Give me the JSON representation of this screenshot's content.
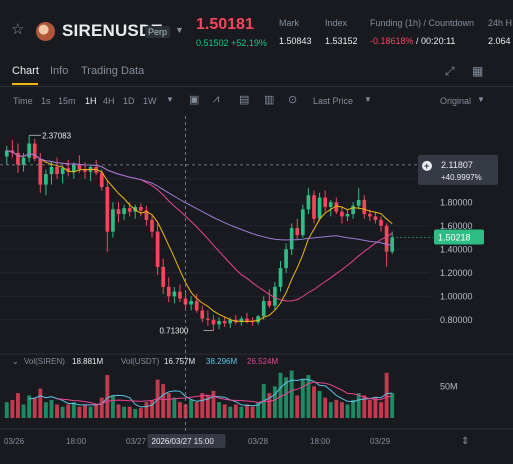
{
  "header": {
    "star_icon": "star-icon",
    "symbol": "SIRENUSDT",
    "contract_badge": "Perp",
    "last_price": "1.50181",
    "sub_price": "0.51502",
    "change_pct": "+52.19%",
    "stats": [
      {
        "label": "Mark",
        "value": "1.50843"
      },
      {
        "label": "Index",
        "value": "1.53152"
      },
      {
        "label": "Funding (1h) / Countdown",
        "value_neg": "-0.18618%",
        "value_rest": " / 00:20:11"
      },
      {
        "label": "24h H",
        "value": "2.064"
      }
    ]
  },
  "tabs": [
    {
      "label": "Chart",
      "active": true
    },
    {
      "label": "Info",
      "active": false
    },
    {
      "label": "Trading Data",
      "active": false
    }
  ],
  "toolbar": {
    "time_label": "Time",
    "timeframes": [
      {
        "label": "1s",
        "active": false
      },
      {
        "label": "15m",
        "active": false
      },
      {
        "label": "1H",
        "active": true
      },
      {
        "label": "4H",
        "active": false
      },
      {
        "label": "1D",
        "active": false
      },
      {
        "label": "1W",
        "active": false
      }
    ],
    "price_type": "Last Price",
    "view_mode": "Original"
  },
  "chart_data": {
    "type": "candlestick",
    "price_axis": [
      "2.00000",
      "1.80000",
      "1.60000",
      "1.40000",
      "1.20000",
      "1.00000",
      "0.80000"
    ],
    "price_range": [
      0.56,
      2.5
    ],
    "high_label": "2.37083",
    "low_label": "0.71300",
    "crosshair": {
      "price": "2.11807",
      "change": "+40.9997%",
      "time": "2026/03/27 15:00"
    },
    "current_price_tag": "1.50218",
    "volume_legend": {
      "name": "Vol(SIREN)",
      "siren": "18.881M",
      "usdt_label": "Vol(USDT)",
      "usdt": "16.757M",
      "ma1": "38.296M",
      "ma2": "26.524M"
    },
    "volume_axis": "50M",
    "time_axis": [
      "03/26",
      "18:00",
      "03/27",
      "18:00",
      "03/28",
      "18:00",
      "03/29"
    ],
    "ohlc": [
      [
        2.19,
        2.28,
        2.12,
        2.24
      ],
      [
        2.24,
        2.33,
        2.18,
        2.22
      ],
      [
        2.22,
        2.3,
        2.05,
        2.12
      ],
      [
        2.12,
        2.22,
        2.06,
        2.18
      ],
      [
        2.18,
        2.37,
        2.14,
        2.3
      ],
      [
        2.3,
        2.34,
        2.15,
        2.17
      ],
      [
        2.17,
        2.22,
        1.88,
        1.95
      ],
      [
        1.95,
        2.08,
        1.86,
        2.04
      ],
      [
        2.04,
        2.15,
        1.95,
        2.1
      ],
      [
        2.1,
        2.18,
        2.0,
        2.04
      ],
      [
        2.04,
        2.12,
        1.96,
        2.09
      ],
      [
        2.09,
        2.16,
        2.02,
        2.06
      ],
      [
        2.06,
        2.14,
        2.0,
        2.12
      ],
      [
        2.12,
        2.2,
        2.05,
        2.08
      ],
      [
        2.08,
        2.14,
        2.0,
        2.06
      ],
      [
        2.06,
        2.12,
        1.98,
        2.1
      ],
      [
        2.1,
        2.16,
        2.03,
        2.05
      ],
      [
        2.05,
        2.08,
        1.9,
        1.93
      ],
      [
        1.93,
        1.98,
        1.38,
        1.55
      ],
      [
        1.55,
        1.8,
        1.5,
        1.74
      ],
      [
        1.74,
        1.8,
        1.63,
        1.7
      ],
      [
        1.7,
        1.78,
        1.65,
        1.75
      ],
      [
        1.75,
        1.8,
        1.68,
        1.72
      ],
      [
        1.72,
        1.78,
        1.66,
        1.76
      ],
      [
        1.76,
        1.79,
        1.68,
        1.73
      ],
      [
        1.73,
        1.77,
        1.6,
        1.65
      ],
      [
        1.65,
        1.7,
        1.5,
        1.55
      ],
      [
        1.55,
        1.62,
        1.18,
        1.25
      ],
      [
        1.25,
        1.32,
        1.02,
        1.08
      ],
      [
        1.08,
        1.16,
        0.95,
        1.0
      ],
      [
        1.0,
        1.08,
        0.94,
        1.04
      ],
      [
        1.04,
        1.1,
        0.95,
        0.98
      ],
      [
        0.98,
        1.04,
        0.9,
        0.93
      ],
      [
        0.93,
        1.0,
        0.88,
        0.96
      ],
      [
        0.96,
        1.02,
        0.86,
        0.88
      ],
      [
        0.88,
        0.92,
        0.78,
        0.81
      ],
      [
        0.81,
        0.88,
        0.75,
        0.8
      ],
      [
        0.8,
        0.84,
        0.71,
        0.76
      ],
      [
        0.76,
        0.82,
        0.72,
        0.79
      ],
      [
        0.79,
        0.83,
        0.74,
        0.77
      ],
      [
        0.77,
        0.82,
        0.73,
        0.8
      ],
      [
        0.8,
        0.84,
        0.76,
        0.78
      ],
      [
        0.78,
        0.83,
        0.75,
        0.81
      ],
      [
        0.81,
        0.86,
        0.77,
        0.79
      ],
      [
        0.79,
        0.82,
        0.75,
        0.78
      ],
      [
        0.78,
        0.84,
        0.76,
        0.83
      ],
      [
        0.83,
        1.0,
        0.8,
        0.96
      ],
      [
        0.96,
        1.06,
        0.9,
        0.92
      ],
      [
        0.92,
        1.12,
        0.88,
        1.08
      ],
      [
        1.08,
        1.3,
        1.04,
        1.24
      ],
      [
        1.24,
        1.45,
        1.2,
        1.4
      ],
      [
        1.4,
        1.62,
        1.35,
        1.58
      ],
      [
        1.58,
        1.66,
        1.48,
        1.52
      ],
      [
        1.52,
        1.78,
        1.5,
        1.74
      ],
      [
        1.74,
        1.92,
        1.7,
        1.86
      ],
      [
        1.86,
        1.9,
        1.62,
        1.66
      ],
      [
        1.66,
        1.88,
        1.64,
        1.84
      ],
      [
        1.84,
        1.9,
        1.72,
        1.76
      ],
      [
        1.76,
        1.82,
        1.68,
        1.8
      ],
      [
        1.8,
        1.84,
        1.7,
        1.72
      ],
      [
        1.72,
        1.76,
        1.62,
        1.68
      ],
      [
        1.68,
        1.74,
        1.64,
        1.7
      ],
      [
        1.7,
        1.8,
        1.66,
        1.77
      ],
      [
        1.77,
        1.92,
        1.74,
        1.82
      ],
      [
        1.82,
        1.86,
        1.66,
        1.7
      ],
      [
        1.7,
        1.74,
        1.64,
        1.68
      ],
      [
        1.68,
        1.72,
        1.62,
        1.65
      ],
      [
        1.65,
        1.68,
        1.55,
        1.6
      ],
      [
        1.6,
        1.62,
        1.25,
        1.38
      ],
      [
        1.38,
        1.55,
        1.36,
        1.5
      ]
    ],
    "volume": [
      14,
      16,
      22,
      12,
      20,
      18,
      26,
      14,
      16,
      12,
      10,
      12,
      14,
      10,
      12,
      10,
      12,
      18,
      38,
      20,
      12,
      10,
      10,
      8,
      9,
      14,
      16,
      34,
      30,
      22,
      18,
      14,
      12,
      16,
      14,
      22,
      20,
      24,
      14,
      12,
      10,
      12,
      10,
      12,
      10,
      14,
      30,
      22,
      28,
      40,
      36,
      42,
      20,
      34,
      38,
      28,
      24,
      18,
      14,
      16,
      14,
      12,
      16,
      22,
      20,
      16,
      18,
      14,
      40,
      22
    ],
    "series": [
      {
        "name": "MA (yellow)",
        "color": "#f0b90b"
      },
      {
        "name": "MA (pink)",
        "color": "#e84393"
      },
      {
        "name": "MA (purple)",
        "color": "#9b7ad8"
      }
    ]
  }
}
